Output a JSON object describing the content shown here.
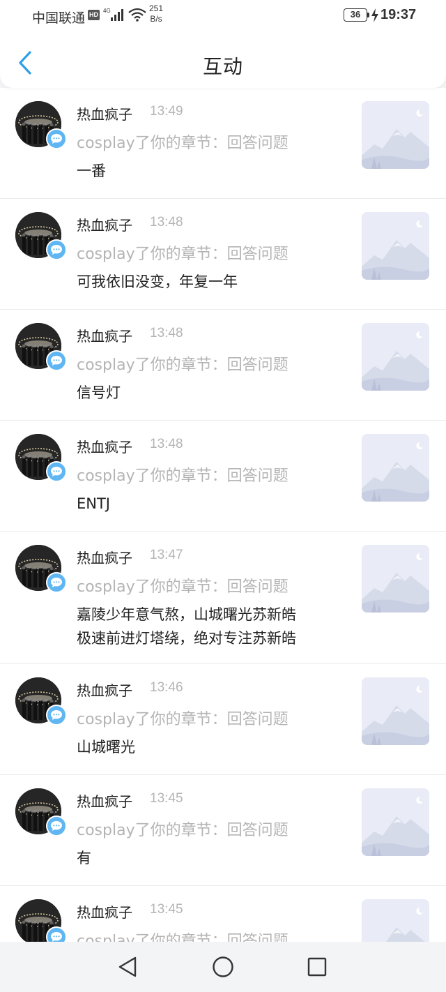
{
  "status_bar": {
    "carrier": "中国联通",
    "hd": "HD",
    "network": "4G",
    "speed_value": "251",
    "speed_unit": "B/s",
    "battery": "36",
    "time": "19:37"
  },
  "header": {
    "title": "互动",
    "back_icon": "chevron-left-icon"
  },
  "colors": {
    "accent": "#5fb6f2",
    "muted_text": "#b4b4b4",
    "primary_text": "#222222"
  },
  "items": [
    {
      "name": "热血疯子",
      "time": "13:49",
      "subtitle": "cosplay了你的章节：回答问题",
      "content": "一番"
    },
    {
      "name": "热血疯子",
      "time": "13:48",
      "subtitle": "cosplay了你的章节：回答问题",
      "content": "可我依旧没变，年复一年"
    },
    {
      "name": "热血疯子",
      "time": "13:48",
      "subtitle": "cosplay了你的章节：回答问题",
      "content": "信号灯"
    },
    {
      "name": "热血疯子",
      "time": "13:48",
      "subtitle": "cosplay了你的章节：回答问题",
      "content": "ENTJ"
    },
    {
      "name": "热血疯子",
      "time": "13:47",
      "subtitle": "cosplay了你的章节：回答问题",
      "content": "嘉陵少年意气熬，山城曙光苏新皓\n极速前进灯塔绕，绝对专注苏新皓"
    },
    {
      "name": "热血疯子",
      "time": "13:46",
      "subtitle": "cosplay了你的章节：回答问题",
      "content": "山城曙光"
    },
    {
      "name": "热血疯子",
      "time": "13:45",
      "subtitle": "cosplay了你的章节：回答问题",
      "content": "有"
    },
    {
      "name": "热血疯子",
      "time": "13:45",
      "subtitle": "cosplay了你的章节：回答问题",
      "content": ""
    }
  ],
  "nav_bar": {
    "back_icon": "triangle-back-icon",
    "home_icon": "circle-home-icon",
    "recents_icon": "square-recents-icon"
  }
}
